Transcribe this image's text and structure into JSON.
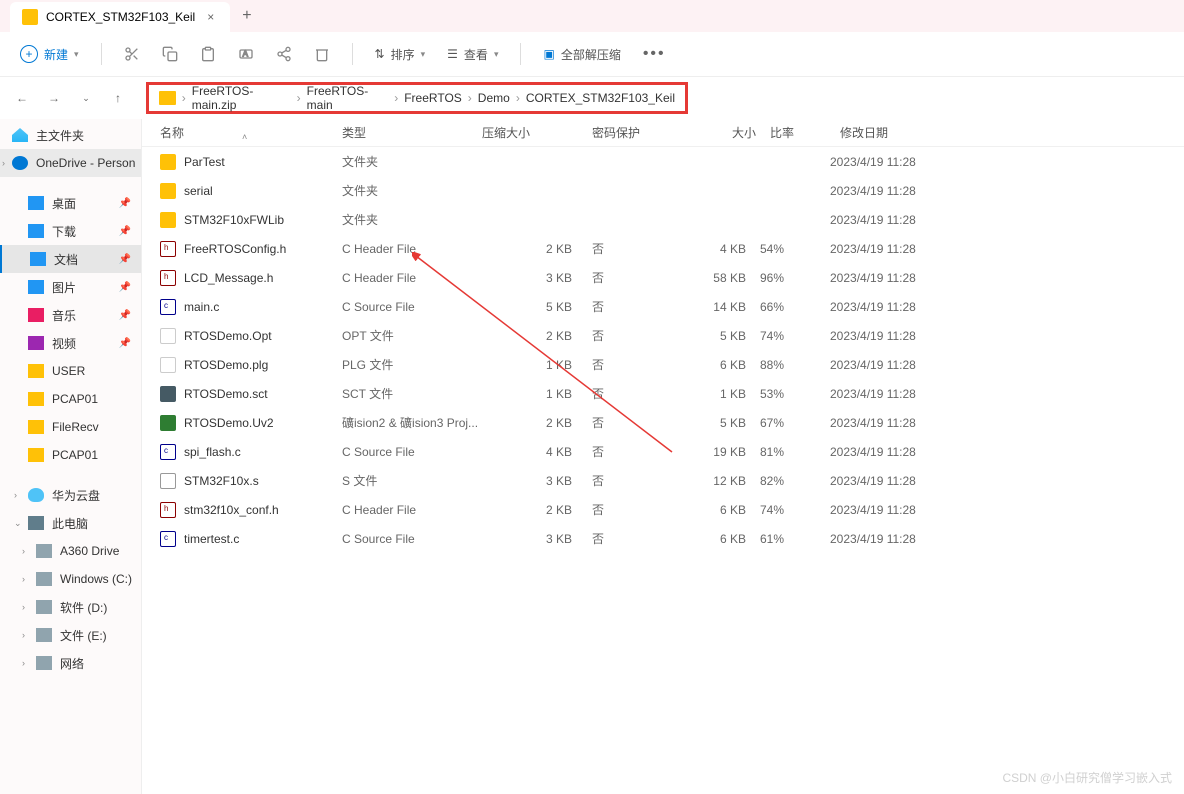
{
  "tab": {
    "title": "CORTEX_STM32F103_Keil"
  },
  "toolbar": {
    "new_label": "新建",
    "sort_label": "排序",
    "view_label": "查看",
    "extract_label": "全部解压缩"
  },
  "breadcrumb": [
    "FreeRTOS-main.zip",
    "FreeRTOS-main",
    "FreeRTOS",
    "Demo",
    "CORTEX_STM32F103_Keil"
  ],
  "sidebar": {
    "home": "主文件夹",
    "onedrive": "OneDrive - Person",
    "quick": [
      {
        "label": "桌面",
        "pin": true,
        "color": "#2196f3"
      },
      {
        "label": "下载",
        "pin": true,
        "color": "#2196f3"
      },
      {
        "label": "文档",
        "pin": true,
        "color": "#2196f3",
        "selected": true
      },
      {
        "label": "图片",
        "pin": true,
        "color": "#2196f3"
      },
      {
        "label": "音乐",
        "pin": true,
        "color": "#e91e63"
      },
      {
        "label": "视频",
        "pin": true,
        "color": "#9c27b0"
      },
      {
        "label": "USER",
        "pin": false,
        "color": "#ffc107"
      },
      {
        "label": "PCAP01",
        "pin": false,
        "color": "#ffc107"
      },
      {
        "label": "FileRecv",
        "pin": false,
        "color": "#ffc107"
      },
      {
        "label": "PCAP01",
        "pin": false,
        "color": "#ffc107"
      }
    ],
    "cloud": "华为云盘",
    "thispc": "此电脑",
    "drives": [
      {
        "label": "A360 Drive"
      },
      {
        "label": "Windows (C:)"
      },
      {
        "label": "软件 (D:)"
      },
      {
        "label": "文件 (E:)"
      },
      {
        "label": "网络"
      }
    ]
  },
  "columns": {
    "name": "名称",
    "type": "类型",
    "csize": "压缩大小",
    "protect": "密码保护",
    "size": "大小",
    "ratio": "比率",
    "date": "修改日期"
  },
  "rows": [
    {
      "icon": "ico-folder",
      "name": "ParTest",
      "type": "文件夹",
      "csize": "",
      "protect": "",
      "size": "",
      "ratio": "",
      "date": "2023/4/19 11:28"
    },
    {
      "icon": "ico-folder",
      "name": "serial",
      "type": "文件夹",
      "csize": "",
      "protect": "",
      "size": "",
      "ratio": "",
      "date": "2023/4/19 11:28"
    },
    {
      "icon": "ico-folder",
      "name": "STM32F10xFWLib",
      "type": "文件夹",
      "csize": "",
      "protect": "",
      "size": "",
      "ratio": "",
      "date": "2023/4/19 11:28"
    },
    {
      "icon": "ico-h",
      "name": "FreeRTOSConfig.h",
      "type": "C Header File",
      "csize": "2 KB",
      "protect": "否",
      "size": "4 KB",
      "ratio": "54%",
      "date": "2023/4/19 11:28"
    },
    {
      "icon": "ico-h",
      "name": "LCD_Message.h",
      "type": "C Header File",
      "csize": "3 KB",
      "protect": "否",
      "size": "58 KB",
      "ratio": "96%",
      "date": "2023/4/19 11:28"
    },
    {
      "icon": "ico-c",
      "name": "main.c",
      "type": "C Source File",
      "csize": "5 KB",
      "protect": "否",
      "size": "14 KB",
      "ratio": "66%",
      "date": "2023/4/19 11:28"
    },
    {
      "icon": "ico-generic",
      "name": "RTOSDemo.Opt",
      "type": "OPT 文件",
      "csize": "2 KB",
      "protect": "否",
      "size": "5 KB",
      "ratio": "74%",
      "date": "2023/4/19 11:28"
    },
    {
      "icon": "ico-generic",
      "name": "RTOSDemo.plg",
      "type": "PLG 文件",
      "csize": "1 KB",
      "protect": "否",
      "size": "6 KB",
      "ratio": "88%",
      "date": "2023/4/19 11:28"
    },
    {
      "icon": "ico-sct",
      "name": "RTOSDemo.sct",
      "type": "SCT 文件",
      "csize": "1 KB",
      "protect": "否",
      "size": "1 KB",
      "ratio": "53%",
      "date": "2023/4/19 11:28"
    },
    {
      "icon": "ico-uv",
      "name": "RTOSDemo.Uv2",
      "type": "礦ision2 & 礦ision3 Proj...",
      "csize": "2 KB",
      "protect": "否",
      "size": "5 KB",
      "ratio": "67%",
      "date": "2023/4/19 11:28"
    },
    {
      "icon": "ico-c",
      "name": "spi_flash.c",
      "type": "C Source File",
      "csize": "4 KB",
      "protect": "否",
      "size": "19 KB",
      "ratio": "81%",
      "date": "2023/4/19 11:28"
    },
    {
      "icon": "ico-s",
      "name": "STM32F10x.s",
      "type": "S 文件",
      "csize": "3 KB",
      "protect": "否",
      "size": "12 KB",
      "ratio": "82%",
      "date": "2023/4/19 11:28"
    },
    {
      "icon": "ico-h",
      "name": "stm32f10x_conf.h",
      "type": "C Header File",
      "csize": "2 KB",
      "protect": "否",
      "size": "6 KB",
      "ratio": "74%",
      "date": "2023/4/19 11:28"
    },
    {
      "icon": "ico-c",
      "name": "timertest.c",
      "type": "C Source File",
      "csize": "3 KB",
      "protect": "否",
      "size": "6 KB",
      "ratio": "61%",
      "date": "2023/4/19 11:28"
    }
  ],
  "watermark": "CSDN @小白研究僧学习嵌入式"
}
